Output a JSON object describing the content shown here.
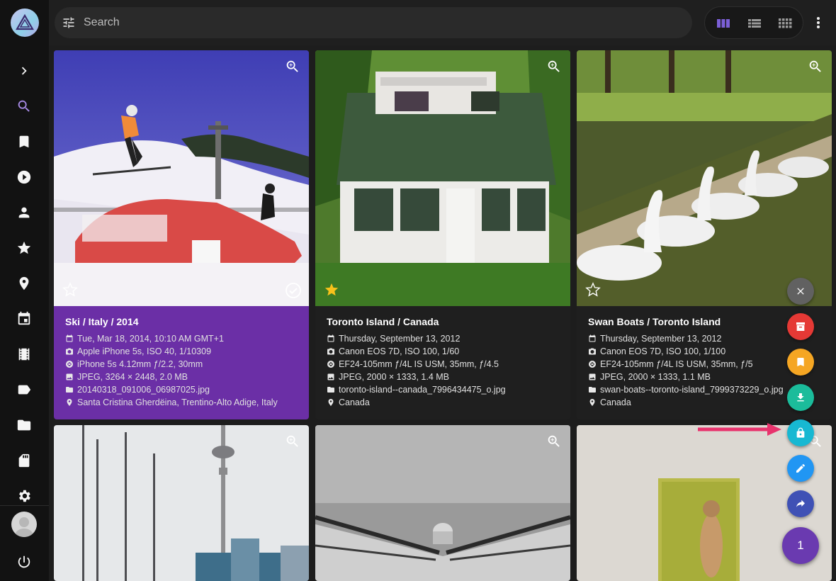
{
  "toolbar": {
    "search_placeholder": "Search",
    "views": [
      "cards-view",
      "list-view",
      "mosaic-view"
    ]
  },
  "sidebar": {
    "items": [
      "expand",
      "search",
      "albums",
      "videos",
      "people",
      "favorites",
      "places",
      "calendar",
      "moments",
      "labels",
      "folders",
      "library",
      "settings"
    ],
    "accent": "#a98ce8"
  },
  "photos": [
    {
      "title": "Ski / Italy / 2014",
      "date": "Tue, Mar 18, 2014, 10:10 AM GMT+1",
      "camera": "Apple iPhone 5s, ISO 40, 1/10309",
      "lens": "iPhone 5s 4.12mm ƒ/2.2, 30mm",
      "file_info": "JPEG, 3264 × 2448, 2.0 MB",
      "filename": "20140318_091006_06987025.jpg",
      "location": "Santa Cristina Gherdëina, Trentino-Alto Adige, Italy",
      "favorite": false,
      "selected": true
    },
    {
      "title": "Toronto Island / Canada",
      "date": "Thursday, September 13, 2012",
      "camera": "Canon EOS 7D, ISO 100, 1/60",
      "lens": "EF24-105mm ƒ/4L IS USM, 35mm, ƒ/4.5",
      "file_info": "JPEG, 2000 × 1333, 1.4 MB",
      "filename": "toronto-island--canada_7996434475_o.jpg",
      "location": "Canada",
      "favorite": true,
      "selected": false
    },
    {
      "title": "Swan Boats / Toronto Island",
      "date": "Thursday, September 13, 2012",
      "camera": "Canon EOS 7D, ISO 100, 1/100",
      "lens": "EF24-105mm ƒ/4L IS USM, 35mm, ƒ/5",
      "file_info": "JPEG, 2000 × 1333, 1.1 MB",
      "filename": "swan-boats--toronto-island_7999373229_o.jpg",
      "location": "Canada",
      "favorite": false,
      "selected": false
    }
  ],
  "clipboard": {
    "count": "1",
    "actions": [
      {
        "name": "close",
        "color": "#616161"
      },
      {
        "name": "archive",
        "color": "#e53935"
      },
      {
        "name": "add-to-album",
        "color": "#f5a623"
      },
      {
        "name": "download",
        "color": "#1bbc9b"
      },
      {
        "name": "private",
        "color": "#17b8d2"
      },
      {
        "name": "edit",
        "color": "#2196f3"
      },
      {
        "name": "share",
        "color": "#3f51b5"
      }
    ]
  }
}
